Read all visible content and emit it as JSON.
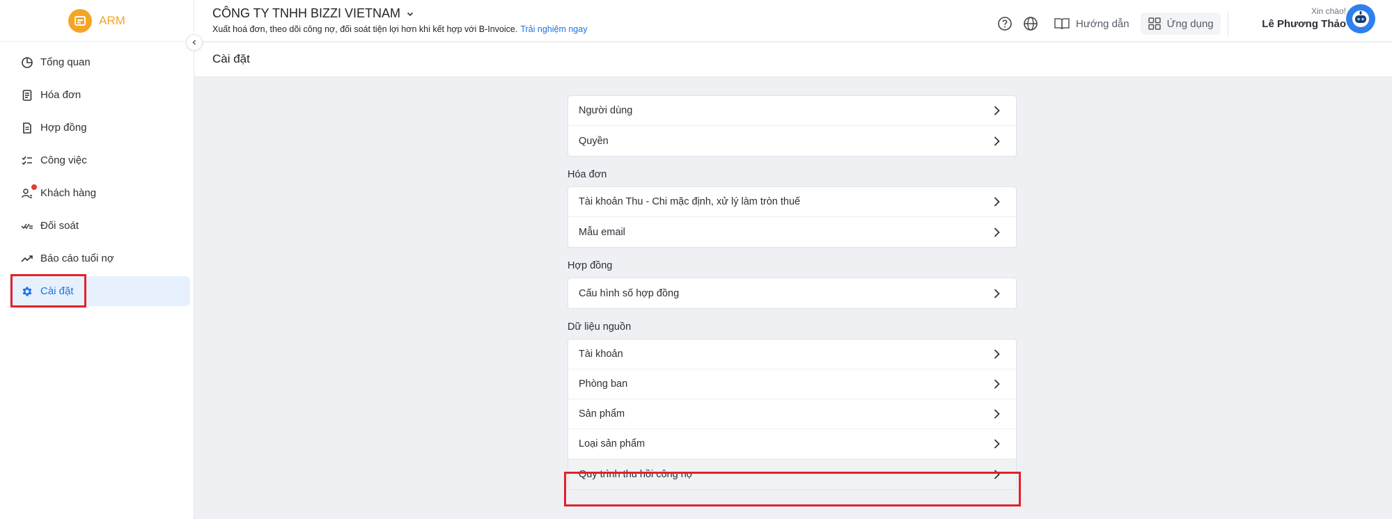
{
  "app": {
    "logo_text": "ARM"
  },
  "sidebar": {
    "items": [
      {
        "label": "Tổng quan",
        "icon": "pie-chart-icon"
      },
      {
        "label": "Hóa đơn",
        "icon": "invoice-icon"
      },
      {
        "label": "Hợp đồng",
        "icon": "document-icon"
      },
      {
        "label": "Công việc",
        "icon": "checklist-icon"
      },
      {
        "label": "Khách hàng",
        "icon": "customers-icon",
        "badge": true
      },
      {
        "label": "Đối soát",
        "icon": "reconcile-icon"
      },
      {
        "label": "Báo cáo tuổi nợ",
        "icon": "trend-up-icon"
      },
      {
        "label": "Cài đặt",
        "icon": "gear-icon",
        "active": true
      }
    ]
  },
  "header": {
    "company_name": "CÔNG TY TNHH BIZZI VIETNAM",
    "promo_text": "Xuất hoá đơn, theo dõi công nợ, đối soát tiện lợi hơn khi kết hợp với B-Invoice.",
    "promo_link": "Trải nghiệm ngay",
    "guide_label": "Hướng dẫn",
    "apps_label": "Ứng dụng",
    "greeting": "Xin chào!",
    "user_name": "Lê Phương Thảo"
  },
  "page": {
    "title": "Cài đặt"
  },
  "settings": {
    "general": [
      "Người dùng",
      "Quyền"
    ],
    "invoice": {
      "title": "Hóa đơn",
      "items": [
        "Tài khoản Thu - Chi mặc định, xử lý làm tròn thuế",
        "Mẫu email"
      ]
    },
    "contract": {
      "title": "Hợp đồng",
      "items": [
        "Cấu hình số hợp đồng"
      ]
    },
    "source_data": {
      "title": "Dữ liệu nguồn",
      "items": [
        "Tài khoản",
        "Phòng ban",
        "Sản phẩm",
        "Loại sản phẩm",
        "Quy trình thu hồi công nợ"
      ]
    }
  },
  "colors": {
    "accent": "#1a73e8",
    "brand": "#f5a524",
    "highlight": "#e3202a"
  }
}
